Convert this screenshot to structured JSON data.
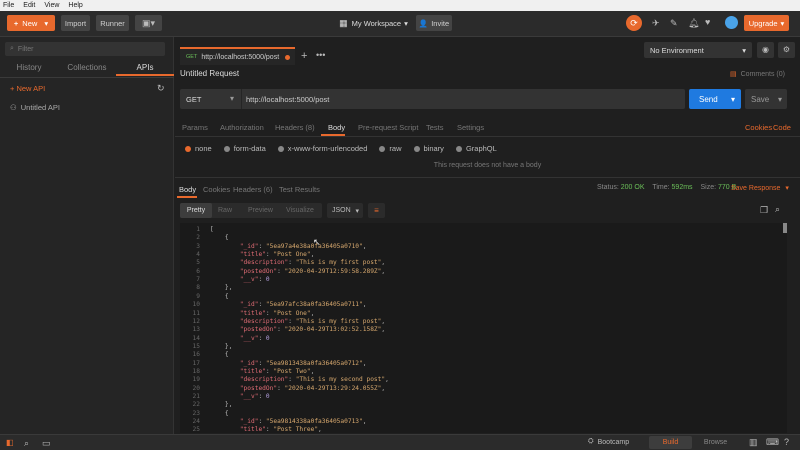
{
  "menubar": {
    "items": [
      "File",
      "Edit",
      "View",
      "Help"
    ]
  },
  "toolbar": {
    "new_label": "New",
    "import_label": "Import",
    "runner_label": "Runner",
    "workspace_label": "My Workspace",
    "invite_label": "Invite",
    "upgrade_label": "Upgrade"
  },
  "sidebar": {
    "search_placeholder": "Filter",
    "tabs": [
      "History",
      "Collections",
      "APIs"
    ],
    "new_api_label": "+ New API",
    "items": [
      {
        "label": "Untitled API"
      }
    ]
  },
  "request_tab": {
    "method": "GET",
    "label": "http://localhost:5000/post"
  },
  "environment": {
    "selected": "No Environment"
  },
  "request": {
    "name": "Untitled Request",
    "comments_label": "Comments (0)",
    "method": "GET",
    "url": "http://localhost:5000/post",
    "send_label": "Send",
    "save_label": "Save",
    "tabs": [
      "Params",
      "Authorization",
      "Headers (8)",
      "Body",
      "Pre-request Script",
      "Tests",
      "Settings"
    ],
    "active_tab": "Body",
    "cookies_label": "Cookies",
    "code_label": "Code",
    "body_types": [
      "none",
      "form-data",
      "x-www-form-urlencoded",
      "raw",
      "binary",
      "GraphQL"
    ],
    "body_message": "This request does not have a body"
  },
  "response": {
    "tabs": [
      "Body",
      "Cookies",
      "Headers (6)",
      "Test Results"
    ],
    "status_label": "Status:",
    "status_value": "200 OK",
    "time_label": "Time:",
    "time_value": "592ms",
    "size_label": "Size:",
    "size_value": "770 B",
    "save_response_label": "Save Response",
    "view_modes": [
      "Pretty",
      "Raw",
      "Preview",
      "Visualize"
    ],
    "format": "JSON",
    "lines": [
      {
        "n": "1",
        "t": "["
      },
      {
        "n": "2",
        "t": "    {"
      },
      {
        "n": "3",
        "key": "\"_id\"",
        "val": "\"5ea97a4e38a0fa36405a0710\"",
        "sep": ","
      },
      {
        "n": "4",
        "key": "\"title\"",
        "val": "\"Post One\"",
        "sep": ","
      },
      {
        "n": "5",
        "key": "\"description\"",
        "val": "\"This is my first post\"",
        "sep": ","
      },
      {
        "n": "6",
        "key": "\"postedOn\"",
        "val": "\"2020-04-29T12:59:58.289Z\"",
        "sep": ","
      },
      {
        "n": "7",
        "key": "\"__v\"",
        "num": "0",
        "sep": ""
      },
      {
        "n": "8",
        "t": "    },"
      },
      {
        "n": "9",
        "t": "    {"
      },
      {
        "n": "10",
        "key": "\"_id\"",
        "val": "\"5ea97afc38a0fa36405a0711\"",
        "sep": ","
      },
      {
        "n": "11",
        "key": "\"title\"",
        "val": "\"Post One\"",
        "sep": ","
      },
      {
        "n": "12",
        "key": "\"description\"",
        "val": "\"This is my first post\"",
        "sep": ","
      },
      {
        "n": "13",
        "key": "\"postedOn\"",
        "val": "\"2020-04-29T13:02:52.158Z\"",
        "sep": ","
      },
      {
        "n": "14",
        "key": "\"__v\"",
        "num": "0",
        "sep": ""
      },
      {
        "n": "15",
        "t": "    },"
      },
      {
        "n": "16",
        "t": "    {"
      },
      {
        "n": "17",
        "key": "\"_id\"",
        "val": "\"5ea9813438a0fa36405a0712\"",
        "sep": ","
      },
      {
        "n": "18",
        "key": "\"title\"",
        "val": "\"Post Two\"",
        "sep": ","
      },
      {
        "n": "19",
        "key": "\"description\"",
        "val": "\"This is my second post\"",
        "sep": ","
      },
      {
        "n": "20",
        "key": "\"postedOn\"",
        "val": "\"2020-04-29T13:29:24.055Z\"",
        "sep": ","
      },
      {
        "n": "21",
        "key": "\"__v\"",
        "num": "0",
        "sep": ""
      },
      {
        "n": "22",
        "t": "    },"
      },
      {
        "n": "23",
        "t": "    {"
      },
      {
        "n": "24",
        "key": "\"_id\"",
        "val": "\"5ea9814338a0fa36405a0713\"",
        "sep": ","
      },
      {
        "n": "25",
        "key": "\"title\"",
        "val": "\"Post Three\"",
        "sep": ","
      }
    ]
  },
  "statusbar": {
    "bootcamp_label": "Bootcamp",
    "build_label": "Build",
    "browse_label": "Browse"
  },
  "colors": {
    "accent": "#e8692d",
    "send": "#1f7ae0",
    "bg": "#1f1f1f"
  }
}
